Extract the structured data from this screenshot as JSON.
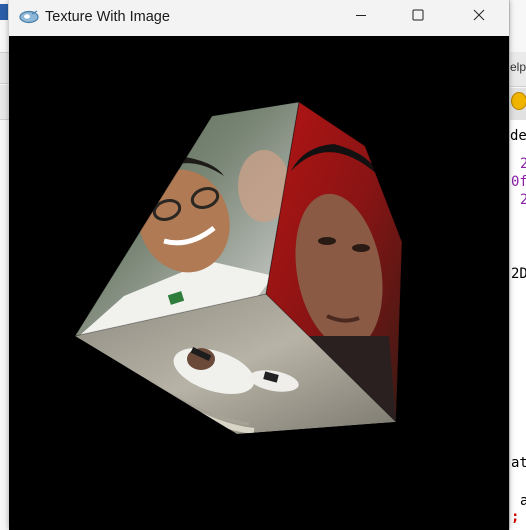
{
  "window": {
    "title": "Texture With Image",
    "controls": {
      "minimize_icon": "minimize-icon",
      "maximize_icon": "maximize-icon",
      "close_icon": "close-icon"
    }
  },
  "background_editor": {
    "fragments": [
      "elp",
      "de",
      "2",
      "0f",
      "2",
      "2D",
      "at",
      "a",
      ";"
    ]
  },
  "scene": {
    "object": "textured-cube",
    "background_color": "#000000",
    "faces": [
      "face-left-photo",
      "face-right-photo",
      "face-bottom-photo"
    ]
  }
}
